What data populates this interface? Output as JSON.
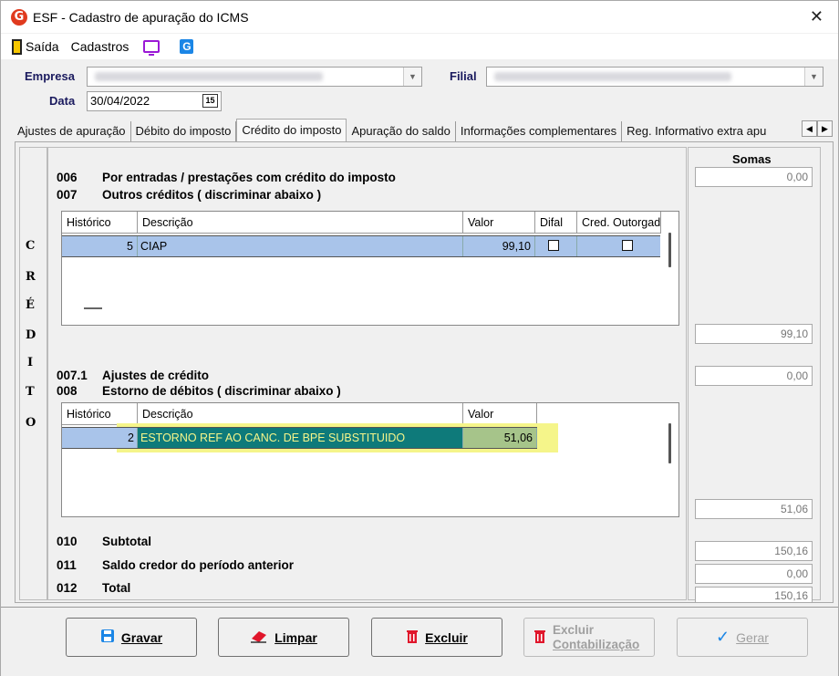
{
  "window": {
    "title": "ESF - Cadastro de apuração do ICMS",
    "close": "✕"
  },
  "menu": {
    "exit": "Saída",
    "cadastros": "Cadastros"
  },
  "form": {
    "empresa_label": "Empresa",
    "filial_label": "Filial",
    "data_label": "Data",
    "data_value": "30/04/2022",
    "calendar_icon": "15"
  },
  "tabs": [
    "Ajustes de apuração",
    "Débito do imposto",
    "Crédito do imposto",
    "Apuração do saldo",
    "Informações complementares",
    "Reg. Informativo extra apu"
  ],
  "side_letters": [
    "C",
    "R",
    "É",
    "D",
    "I",
    "T",
    "O"
  ],
  "sections": {
    "l006_code": "006",
    "l006_text": "Por entradas / prestações com crédito do imposto",
    "l007_code": "007",
    "l007_text": "Outros créditos ( discriminar abaixo )",
    "l0071_code": "007.1",
    "l0071_text": "Ajustes de crédito",
    "l008_code": "008",
    "l008_text": "Estorno de débitos ( discriminar abaixo )",
    "l010_code": "010",
    "l010_text": "Subtotal",
    "l011_code": "011",
    "l011_text": "Saldo credor do período anterior",
    "l012_code": "012",
    "l012_text": "Total"
  },
  "grid1": {
    "headers": [
      "Histórico",
      "Descrição",
      "Valor",
      "Difal",
      "Cred. Outorgado"
    ],
    "row": {
      "historico": "5",
      "descricao": "CIAP",
      "valor": "99,10"
    }
  },
  "grid2": {
    "headers": [
      "Histórico",
      "Descrição",
      "Valor"
    ],
    "row": {
      "historico": "2",
      "descricao": "ESTORNO REF AO CANC. DE BPE SUBSTITUIDO",
      "valor": "51,06"
    }
  },
  "somas": {
    "title": "Somas",
    "s006": "0,00",
    "s007": "99,10",
    "s0071": "0,00",
    "s008": "51,06",
    "s010": "150,16",
    "s011": "0,00",
    "s012": "150,16"
  },
  "buttons": {
    "gravar": "Gravar",
    "limpar": "Limpar",
    "excluir": "Excluir",
    "excluir_cont_1": "Excluir",
    "excluir_cont_2": "Contabilização",
    "gerar": "Gerar"
  },
  "colors": {
    "accent": "#1b86e6",
    "selected_row": "#a9c4ea",
    "highlight": "#f5f58a",
    "teal_cell": "#0e7a7a"
  }
}
